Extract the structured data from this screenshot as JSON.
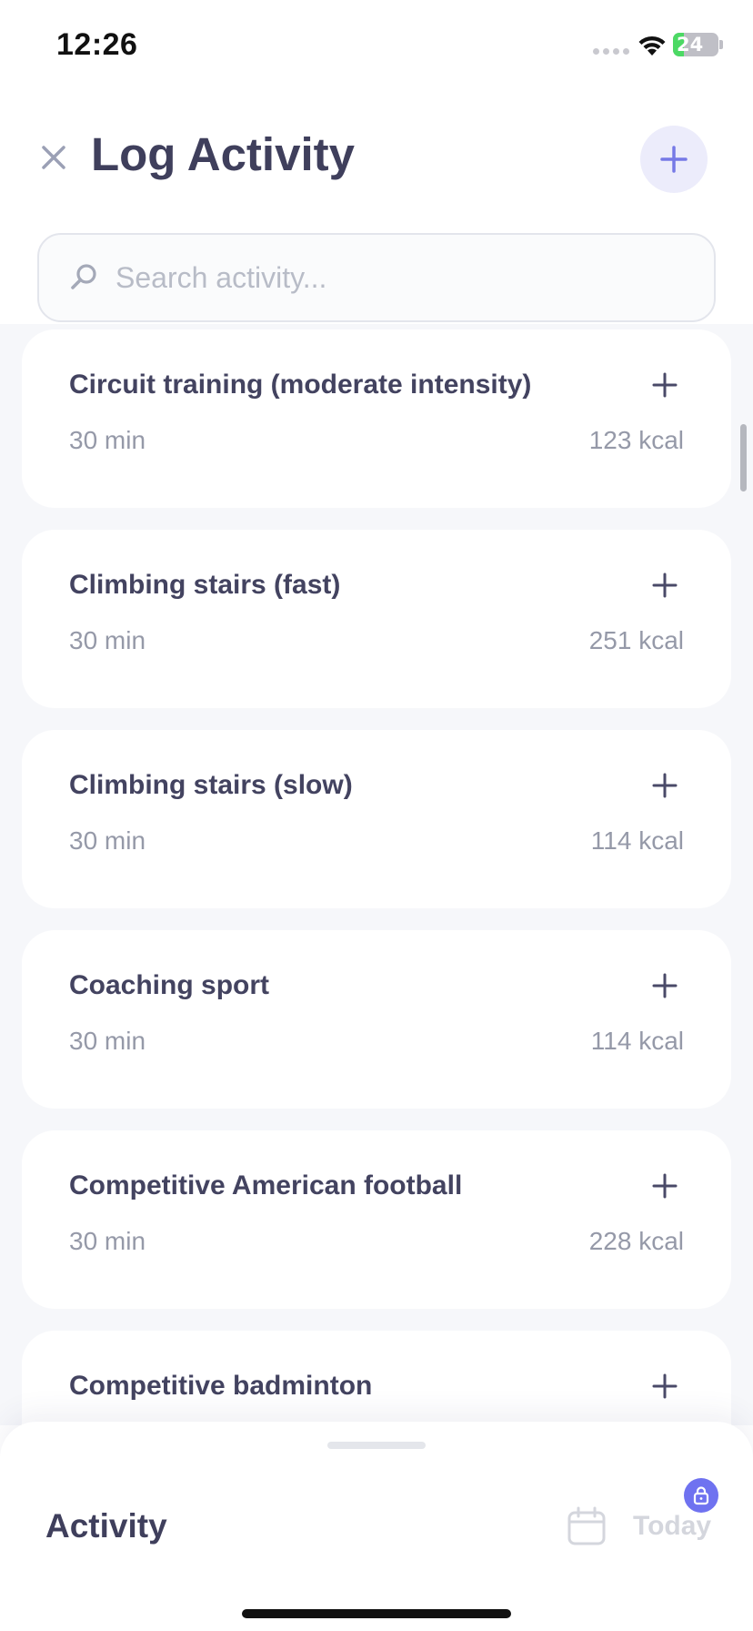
{
  "status_bar": {
    "time": "12:26",
    "battery_level": "24",
    "battery_fill_percent": 24,
    "battery_color": "#4cd964"
  },
  "header": {
    "title": "Log Activity",
    "close_icon": "close-icon",
    "add_icon": "plus-icon"
  },
  "search": {
    "placeholder": "Search activity..."
  },
  "activities": [
    {
      "name": "Circuit training (moderate intensity)",
      "duration": "30 min",
      "kcal": "123 kcal"
    },
    {
      "name": "Climbing stairs (fast)",
      "duration": "30 min",
      "kcal": "251 kcal"
    },
    {
      "name": "Climbing stairs (slow)",
      "duration": "30 min",
      "kcal": "114 kcal"
    },
    {
      "name": "Coaching sport",
      "duration": "30 min",
      "kcal": "114 kcal"
    },
    {
      "name": "Competitive American football",
      "duration": "30 min",
      "kcal": "228 kcal"
    },
    {
      "name": "Competitive badminton",
      "duration": "",
      "kcal": ""
    }
  ],
  "bottom_sheet": {
    "title": "Activity",
    "date_label": "Today",
    "calendar_icon": "calendar-icon",
    "lock_icon": "lock-icon"
  },
  "colors": {
    "accent": "#6f72f0",
    "title_text": "#3f3f5c",
    "muted_text": "#9599a8"
  }
}
